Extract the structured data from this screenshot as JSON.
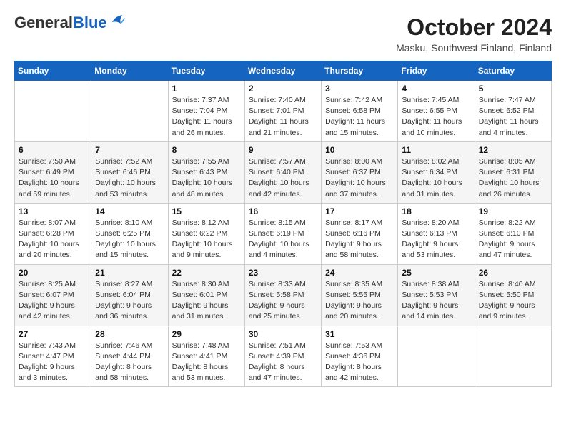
{
  "header": {
    "logo_general": "General",
    "logo_blue": "Blue",
    "month": "October 2024",
    "location": "Masku, Southwest Finland, Finland"
  },
  "weekdays": [
    "Sunday",
    "Monday",
    "Tuesday",
    "Wednesday",
    "Thursday",
    "Friday",
    "Saturday"
  ],
  "weeks": [
    [
      {
        "day": "",
        "info": ""
      },
      {
        "day": "",
        "info": ""
      },
      {
        "day": "1",
        "info": "Sunrise: 7:37 AM\nSunset: 7:04 PM\nDaylight: 11 hours and 26 minutes."
      },
      {
        "day": "2",
        "info": "Sunrise: 7:40 AM\nSunset: 7:01 PM\nDaylight: 11 hours and 21 minutes."
      },
      {
        "day": "3",
        "info": "Sunrise: 7:42 AM\nSunset: 6:58 PM\nDaylight: 11 hours and 15 minutes."
      },
      {
        "day": "4",
        "info": "Sunrise: 7:45 AM\nSunset: 6:55 PM\nDaylight: 11 hours and 10 minutes."
      },
      {
        "day": "5",
        "info": "Sunrise: 7:47 AM\nSunset: 6:52 PM\nDaylight: 11 hours and 4 minutes."
      }
    ],
    [
      {
        "day": "6",
        "info": "Sunrise: 7:50 AM\nSunset: 6:49 PM\nDaylight: 10 hours and 59 minutes."
      },
      {
        "day": "7",
        "info": "Sunrise: 7:52 AM\nSunset: 6:46 PM\nDaylight: 10 hours and 53 minutes."
      },
      {
        "day": "8",
        "info": "Sunrise: 7:55 AM\nSunset: 6:43 PM\nDaylight: 10 hours and 48 minutes."
      },
      {
        "day": "9",
        "info": "Sunrise: 7:57 AM\nSunset: 6:40 PM\nDaylight: 10 hours and 42 minutes."
      },
      {
        "day": "10",
        "info": "Sunrise: 8:00 AM\nSunset: 6:37 PM\nDaylight: 10 hours and 37 minutes."
      },
      {
        "day": "11",
        "info": "Sunrise: 8:02 AM\nSunset: 6:34 PM\nDaylight: 10 hours and 31 minutes."
      },
      {
        "day": "12",
        "info": "Sunrise: 8:05 AM\nSunset: 6:31 PM\nDaylight: 10 hours and 26 minutes."
      }
    ],
    [
      {
        "day": "13",
        "info": "Sunrise: 8:07 AM\nSunset: 6:28 PM\nDaylight: 10 hours and 20 minutes."
      },
      {
        "day": "14",
        "info": "Sunrise: 8:10 AM\nSunset: 6:25 PM\nDaylight: 10 hours and 15 minutes."
      },
      {
        "day": "15",
        "info": "Sunrise: 8:12 AM\nSunset: 6:22 PM\nDaylight: 10 hours and 9 minutes."
      },
      {
        "day": "16",
        "info": "Sunrise: 8:15 AM\nSunset: 6:19 PM\nDaylight: 10 hours and 4 minutes."
      },
      {
        "day": "17",
        "info": "Sunrise: 8:17 AM\nSunset: 6:16 PM\nDaylight: 9 hours and 58 minutes."
      },
      {
        "day": "18",
        "info": "Sunrise: 8:20 AM\nSunset: 6:13 PM\nDaylight: 9 hours and 53 minutes."
      },
      {
        "day": "19",
        "info": "Sunrise: 8:22 AM\nSunset: 6:10 PM\nDaylight: 9 hours and 47 minutes."
      }
    ],
    [
      {
        "day": "20",
        "info": "Sunrise: 8:25 AM\nSunset: 6:07 PM\nDaylight: 9 hours and 42 minutes."
      },
      {
        "day": "21",
        "info": "Sunrise: 8:27 AM\nSunset: 6:04 PM\nDaylight: 9 hours and 36 minutes."
      },
      {
        "day": "22",
        "info": "Sunrise: 8:30 AM\nSunset: 6:01 PM\nDaylight: 9 hours and 31 minutes."
      },
      {
        "day": "23",
        "info": "Sunrise: 8:33 AM\nSunset: 5:58 PM\nDaylight: 9 hours and 25 minutes."
      },
      {
        "day": "24",
        "info": "Sunrise: 8:35 AM\nSunset: 5:55 PM\nDaylight: 9 hours and 20 minutes."
      },
      {
        "day": "25",
        "info": "Sunrise: 8:38 AM\nSunset: 5:53 PM\nDaylight: 9 hours and 14 minutes."
      },
      {
        "day": "26",
        "info": "Sunrise: 8:40 AM\nSunset: 5:50 PM\nDaylight: 9 hours and 9 minutes."
      }
    ],
    [
      {
        "day": "27",
        "info": "Sunrise: 7:43 AM\nSunset: 4:47 PM\nDaylight: 9 hours and 3 minutes."
      },
      {
        "day": "28",
        "info": "Sunrise: 7:46 AM\nSunset: 4:44 PM\nDaylight: 8 hours and 58 minutes."
      },
      {
        "day": "29",
        "info": "Sunrise: 7:48 AM\nSunset: 4:41 PM\nDaylight: 8 hours and 53 minutes."
      },
      {
        "day": "30",
        "info": "Sunrise: 7:51 AM\nSunset: 4:39 PM\nDaylight: 8 hours and 47 minutes."
      },
      {
        "day": "31",
        "info": "Sunrise: 7:53 AM\nSunset: 4:36 PM\nDaylight: 8 hours and 42 minutes."
      },
      {
        "day": "",
        "info": ""
      },
      {
        "day": "",
        "info": ""
      }
    ]
  ]
}
